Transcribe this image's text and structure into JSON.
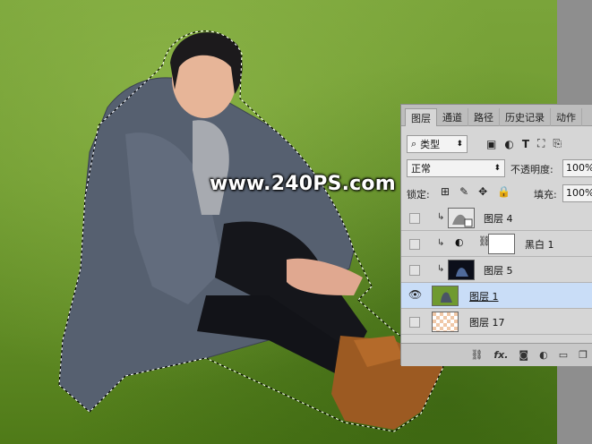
{
  "watermark": "www.240PS.com",
  "panel": {
    "tabs": [
      "图层",
      "通道",
      "路径",
      "历史记录",
      "动作"
    ],
    "active_tab": "图层",
    "filter_select": "类型",
    "filter_icons": [
      "image-icon",
      "adjustment-icon",
      "text-icon",
      "shape-icon",
      "smart-object-icon"
    ],
    "blend_mode": "正常",
    "opacity_label": "不透明度:",
    "opacity_value": "100%",
    "lock_label": "锁定:",
    "lock_icons": [
      "lock-transparent-icon",
      "lock-brush-icon",
      "lock-move-icon",
      "lock-all-icon"
    ],
    "fill_label": "填充:",
    "fill_value": "100%",
    "layers": [
      {
        "name": "图层 4",
        "visible": false,
        "clipped": true,
        "selected": false
      },
      {
        "name": "黑白 1",
        "visible": false,
        "clipped": true,
        "selected": false,
        "adjustment": true
      },
      {
        "name": "图层 5",
        "visible": false,
        "clipped": true,
        "selected": false
      },
      {
        "name": "图层 1",
        "visible": true,
        "clipped": false,
        "selected": true
      },
      {
        "name": "图层 17",
        "visible": false,
        "clipped": false,
        "selected": false
      }
    ],
    "bottom_icons": [
      "link-icon",
      "fx-icon",
      "mask-icon",
      "adjustment-icon",
      "folder-icon",
      "new-layer-icon"
    ],
    "fx_label": "fx."
  }
}
